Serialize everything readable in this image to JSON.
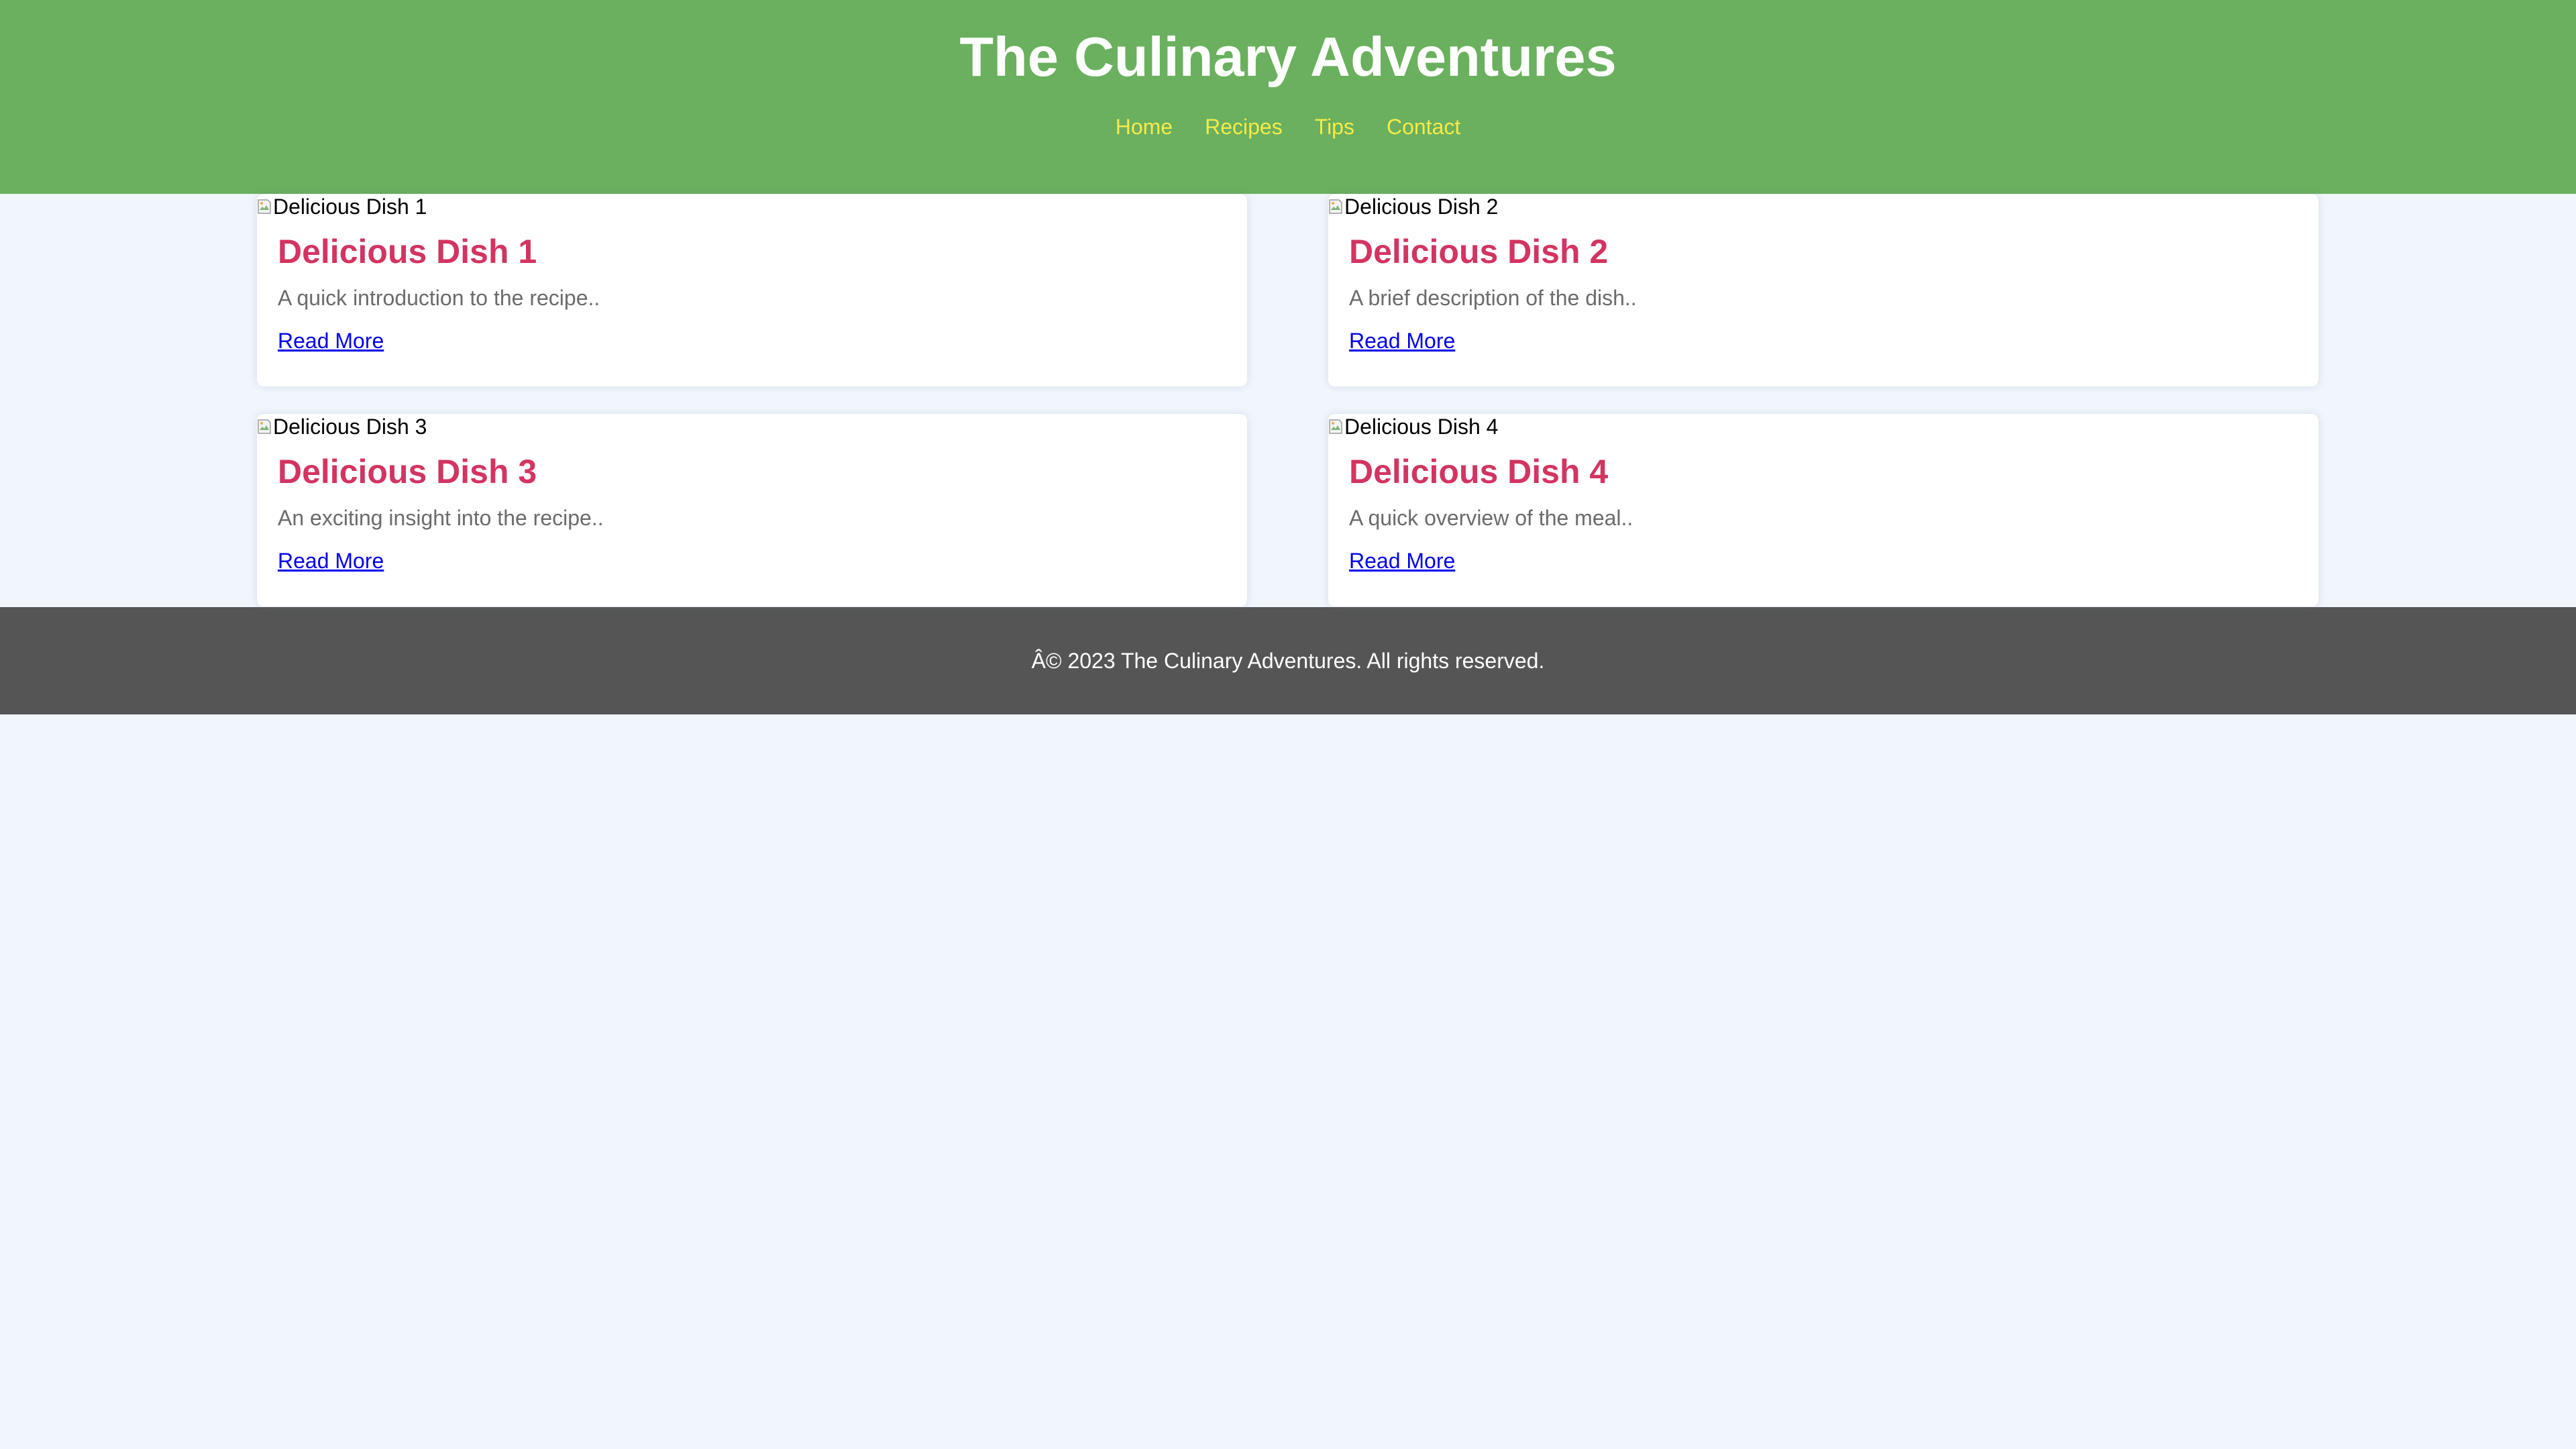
{
  "site": {
    "title": "The Culinary Adventures"
  },
  "nav": {
    "items": [
      {
        "label": "Home"
      },
      {
        "label": "Recipes"
      },
      {
        "label": "Tips"
      },
      {
        "label": "Contact"
      }
    ]
  },
  "recipes": [
    {
      "image_alt": "Delicious Dish 1",
      "title": "Delicious Dish 1",
      "description": "A quick introduction to the recipe..",
      "link_label": "Read More"
    },
    {
      "image_alt": "Delicious Dish 2",
      "title": "Delicious Dish 2",
      "description": "A brief description of the dish..",
      "link_label": "Read More"
    },
    {
      "image_alt": "Delicious Dish 3",
      "title": "Delicious Dish 3",
      "description": "An exciting insight into the recipe..",
      "link_label": "Read More"
    },
    {
      "image_alt": "Delicious Dish 4",
      "title": "Delicious Dish 4",
      "description": "A quick overview of the meal..",
      "link_label": "Read More"
    }
  ],
  "footer": {
    "text": "Â© 2023 The Culinary Adventures. All rights reserved."
  },
  "colors": {
    "header_bg": "#6ab05e",
    "nav_link": "#f5eb4a",
    "card_title": "#d33461",
    "footer_bg": "#555555",
    "page_bg": "#f1f6fd"
  },
  "icons": {
    "card_image": "broken-image-icon"
  }
}
